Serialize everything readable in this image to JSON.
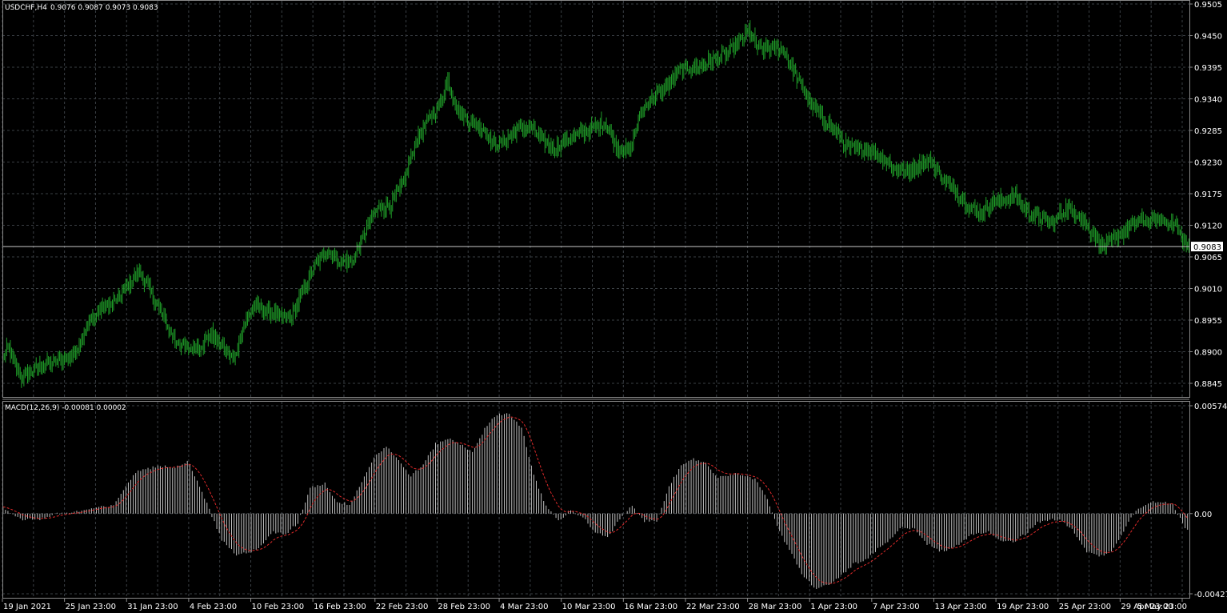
{
  "colors": {
    "background": "#000000",
    "grid": "#3a3f44",
    "frame": "#8a8a8a",
    "candle_bull": "#1f9c28",
    "candle_bear": "#1f9c28",
    "histogram": "#c0c0c0",
    "signal_line": "#e02a2a",
    "text": "#ffffff"
  },
  "header": {
    "symbol_label": "USDCHF,H4",
    "ohlc": "0.9076 0.9087 0.9073 0.9083"
  },
  "macd_header": {
    "label": "MACD(12,26,9) -0.00081 0.00002"
  },
  "current_price": {
    "value": 0.9083,
    "label": "0.9083"
  },
  "chart_data": [
    {
      "type": "candlestick",
      "symbol": "USDCHF",
      "timeframe": "H4",
      "ylim": [
        0.8818,
        0.9505
      ],
      "y_ticks": [
        "0.9505",
        "0.9450",
        "0.9395",
        "0.9340",
        "0.9285",
        "0.9230",
        "0.9175",
        "0.9120",
        "0.9065",
        "0.9010",
        "0.8955",
        "0.8900",
        "0.8845"
      ],
      "x_ticks": [
        "19 Jan 2021",
        "25 Jan 23:00",
        "31 Jan 23:00",
        "4 Feb 23:00",
        "10 Feb 23:00",
        "16 Feb 23:00",
        "22 Feb 23:00",
        "28 Feb 23:00",
        "4 Mar 23:00",
        "10 Mar 23:00",
        "16 Mar 23:00",
        "22 Mar 23:00",
        "28 Mar 23:00",
        "1 Apr 23:00",
        "7 Apr 23:00",
        "13 Apr 23:00",
        "19 Apr 23:00",
        "25 Apr 23:00",
        "29 Apr 23:00",
        "5 May 23:00"
      ],
      "grid": true,
      "close_anchors": [
        [
          0,
          0.8885
        ],
        [
          4,
          0.891
        ],
        [
          10,
          0.8875
        ],
        [
          15,
          0.8855
        ],
        [
          25,
          0.8868
        ],
        [
          35,
          0.888
        ],
        [
          45,
          0.8885
        ],
        [
          55,
          0.889
        ],
        [
          60,
          0.8905
        ],
        [
          70,
          0.895
        ],
        [
          80,
          0.8975
        ],
        [
          90,
          0.8985
        ],
        [
          100,
          0.901
        ],
        [
          110,
          0.904
        ],
        [
          120,
          0.9005
        ],
        [
          130,
          0.896
        ],
        [
          140,
          0.892
        ],
        [
          150,
          0.8905
        ],
        [
          160,
          0.891
        ],
        [
          170,
          0.893
        ],
        [
          180,
          0.8905
        ],
        [
          188,
          0.8885
        ],
        [
          195,
          0.894
        ],
        [
          205,
          0.898
        ],
        [
          215,
          0.897
        ],
        [
          225,
          0.896
        ],
        [
          235,
          0.896
        ],
        [
          245,
          0.901
        ],
        [
          255,
          0.9055
        ],
        [
          265,
          0.9075
        ],
        [
          275,
          0.9055
        ],
        [
          285,
          0.906
        ],
        [
          295,
          0.911
        ],
        [
          305,
          0.915
        ],
        [
          315,
          0.9155
        ],
        [
          325,
          0.919
        ],
        [
          335,
          0.926
        ],
        [
          345,
          0.93
        ],
        [
          355,
          0.933
        ],
        [
          362,
          0.937
        ],
        [
          370,
          0.932
        ],
        [
          380,
          0.93
        ],
        [
          390,
          0.929
        ],
        [
          400,
          0.926
        ],
        [
          410,
          0.927
        ],
        [
          420,
          0.929
        ],
        [
          430,
          0.929
        ],
        [
          440,
          0.9265
        ],
        [
          450,
          0.9255
        ],
        [
          460,
          0.927
        ],
        [
          470,
          0.928
        ],
        [
          480,
          0.929
        ],
        [
          490,
          0.93
        ],
        [
          500,
          0.9255
        ],
        [
          510,
          0.925
        ],
        [
          520,
          0.932
        ],
        [
          530,
          0.9345
        ],
        [
          540,
          0.936
        ],
        [
          550,
          0.939
        ],
        [
          560,
          0.9395
        ],
        [
          570,
          0.94
        ],
        [
          580,
          0.941
        ],
        [
          590,
          0.942
        ],
        [
          600,
          0.944
        ],
        [
          607,
          0.946
        ],
        [
          615,
          0.9425
        ],
        [
          625,
          0.943
        ],
        [
          635,
          0.9425
        ],
        [
          645,
          0.938
        ],
        [
          655,
          0.934
        ],
        [
          665,
          0.931
        ],
        [
          675,
          0.929
        ],
        [
          685,
          0.926
        ],
        [
          695,
          0.925
        ],
        [
          705,
          0.9255
        ],
        [
          715,
          0.924
        ],
        [
          725,
          0.922
        ],
        [
          735,
          0.921
        ],
        [
          745,
          0.9225
        ],
        [
          755,
          0.923
        ],
        [
          765,
          0.92
        ],
        [
          775,
          0.918
        ],
        [
          785,
          0.9155
        ],
        [
          795,
          0.914
        ],
        [
          805,
          0.916
        ],
        [
          815,
          0.9165
        ],
        [
          825,
          0.917
        ],
        [
          835,
          0.914
        ],
        [
          845,
          0.913
        ],
        [
          855,
          0.9125
        ],
        [
          865,
          0.915
        ],
        [
          875,
          0.914
        ],
        [
          885,
          0.911
        ],
        [
          895,
          0.9085
        ],
        [
          905,
          0.9095
        ],
        [
          915,
          0.9115
        ],
        [
          925,
          0.913
        ],
        [
          935,
          0.9125
        ],
        [
          945,
          0.913
        ],
        [
          955,
          0.912
        ],
        [
          960,
          0.9095
        ],
        [
          965,
          0.9083
        ]
      ]
    },
    {
      "type": "bar",
      "name": "MACD(12,26,9)",
      "ylim": [
        -0.00427,
        0.00574
      ],
      "y_ticks": [
        "0.00574",
        "0.00",
        "-0.00427"
      ],
      "main_value": -0.00081,
      "signal_value": 2e-05,
      "macd_anchors": [
        [
          0,
          0.0003
        ],
        [
          15,
          -0.0003
        ],
        [
          30,
          -0.0003
        ],
        [
          45,
          0.0
        ],
        [
          60,
          0.0001
        ],
        [
          75,
          0.0003
        ],
        [
          90,
          0.0004
        ],
        [
          100,
          0.0015
        ],
        [
          110,
          0.0023
        ],
        [
          125,
          0.0025
        ],
        [
          140,
          0.0025
        ],
        [
          150,
          0.0028
        ],
        [
          158,
          0.0018
        ],
        [
          168,
          0.0002
        ],
        [
          178,
          -0.0014
        ],
        [
          190,
          -0.0022
        ],
        [
          200,
          -0.0021
        ],
        [
          210,
          -0.0017
        ],
        [
          220,
          -0.001
        ],
        [
          230,
          -0.0011
        ],
        [
          240,
          -0.0005
        ],
        [
          250,
          0.0014
        ],
        [
          262,
          0.0016
        ],
        [
          272,
          0.0006
        ],
        [
          282,
          0.0005
        ],
        [
          292,
          0.0017
        ],
        [
          302,
          0.003
        ],
        [
          312,
          0.0036
        ],
        [
          322,
          0.0028
        ],
        [
          332,
          0.002
        ],
        [
          342,
          0.0026
        ],
        [
          352,
          0.0037
        ],
        [
          362,
          0.004
        ],
        [
          372,
          0.0037
        ],
        [
          382,
          0.0033
        ],
        [
          392,
          0.0045
        ],
        [
          402,
          0.0053
        ],
        [
          412,
          0.0053
        ],
        [
          422,
          0.0046
        ],
        [
          432,
          0.002
        ],
        [
          442,
          0.0004
        ],
        [
          452,
          -0.0004
        ],
        [
          462,
          0.0002
        ],
        [
          472,
          -0.0002
        ],
        [
          482,
          -0.001
        ],
        [
          492,
          -0.0013
        ],
        [
          502,
          -0.0003
        ],
        [
          512,
          0.0004
        ],
        [
          522,
          -0.0004
        ],
        [
          532,
          -0.0004
        ],
        [
          542,
          0.0015
        ],
        [
          552,
          0.0025
        ],
        [
          562,
          0.0029
        ],
        [
          572,
          0.0027
        ],
        [
          582,
          0.0019
        ],
        [
          592,
          0.0021
        ],
        [
          602,
          0.0021
        ],
        [
          612,
          0.0018
        ],
        [
          622,
          0.0008
        ],
        [
          632,
          -0.001
        ],
        [
          642,
          -0.0022
        ],
        [
          652,
          -0.0034
        ],
        [
          662,
          -0.004
        ],
        [
          672,
          -0.0038
        ],
        [
          682,
          -0.0033
        ],
        [
          692,
          -0.0027
        ],
        [
          702,
          -0.0025
        ],
        [
          712,
          -0.0019
        ],
        [
          722,
          -0.0014
        ],
        [
          732,
          -0.0007
        ],
        [
          742,
          -0.0008
        ],
        [
          752,
          -0.0016
        ],
        [
          762,
          -0.002
        ],
        [
          772,
          -0.0019
        ],
        [
          782,
          -0.0014
        ],
        [
          792,
          -0.001
        ],
        [
          802,
          -0.001
        ],
        [
          812,
          -0.0014
        ],
        [
          822,
          -0.0015
        ],
        [
          832,
          -0.0011
        ],
        [
          842,
          -0.0005
        ],
        [
          852,
          -0.0003
        ],
        [
          862,
          -0.0004
        ],
        [
          872,
          -0.001
        ],
        [
          882,
          -0.002
        ],
        [
          892,
          -0.0023
        ],
        [
          902,
          -0.002
        ],
        [
          912,
          -0.0009
        ],
        [
          922,
          0.0002
        ],
        [
          932,
          0.0006
        ],
        [
          942,
          0.0006
        ],
        [
          952,
          0.0005
        ],
        [
          962,
          -0.0008
        ]
      ]
    }
  ]
}
